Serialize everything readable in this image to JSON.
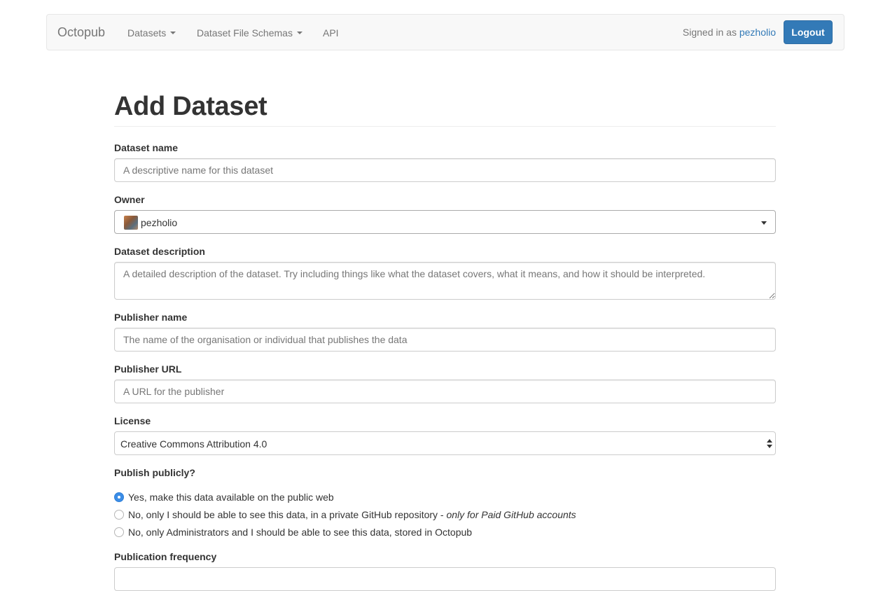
{
  "navbar": {
    "brand": "Octopub",
    "items": [
      {
        "label": "Datasets"
      },
      {
        "label": "Dataset File Schemas"
      },
      {
        "label": "API"
      }
    ],
    "signed_in_prefix": "Signed in as",
    "username": "pezholio",
    "logout_label": "Logout"
  },
  "page": {
    "title": "Add Dataset"
  },
  "form": {
    "dataset_name": {
      "label": "Dataset name",
      "placeholder": "A descriptive name for this dataset",
      "value": ""
    },
    "owner": {
      "label": "Owner",
      "value": "pezholio"
    },
    "dataset_description": {
      "label": "Dataset description",
      "placeholder": "A detailed description of the dataset. Try including things like what the dataset covers, what it means, and how it should be interpreted.",
      "value": ""
    },
    "publisher_name": {
      "label": "Publisher name",
      "placeholder": "The name of the organisation or individual that publishes the data",
      "value": ""
    },
    "publisher_url": {
      "label": "Publisher URL",
      "placeholder": "A URL for the publisher",
      "value": ""
    },
    "license": {
      "label": "License",
      "value": "Creative Commons Attribution 4.0"
    },
    "publish_publicly": {
      "label": "Publish publicly?",
      "options": [
        {
          "label": "Yes, make this data available on the public web",
          "emphasis": "",
          "checked": true
        },
        {
          "label": "No, only I should be able to see this data, in a private GitHub repository - ",
          "emphasis": "only for Paid GitHub accounts",
          "checked": false
        },
        {
          "label": "No, only Administrators and I should be able to see this data, stored in Octopub",
          "emphasis": "",
          "checked": false
        }
      ]
    },
    "publication_frequency": {
      "label": "Publication frequency"
    }
  },
  "colors": {
    "primary": "#337ab7",
    "navbar_bg": "#f8f8f8",
    "radio_checked": "#3b8de6"
  }
}
